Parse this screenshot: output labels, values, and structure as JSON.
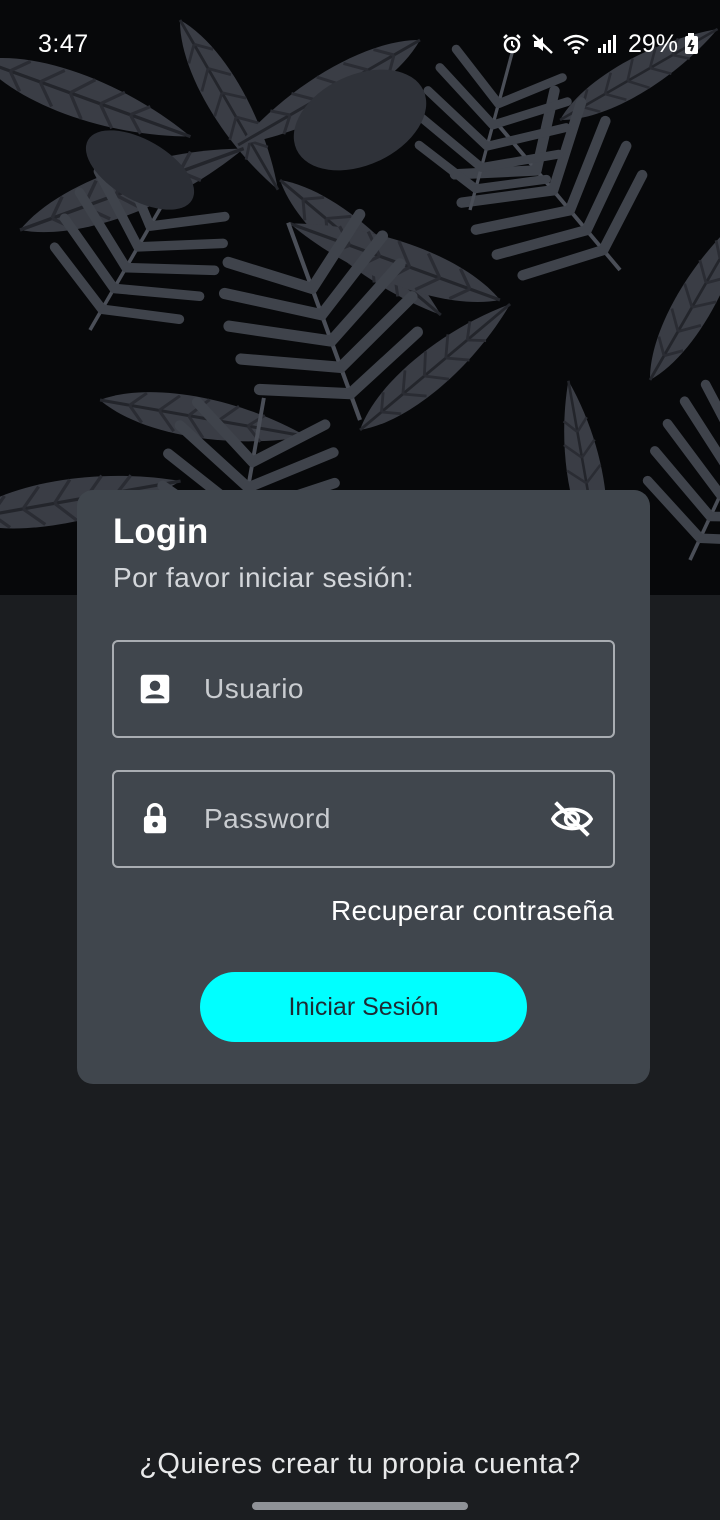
{
  "status_bar": {
    "time": "3:47",
    "battery": "29%",
    "icons": [
      "alarm-icon",
      "mute-icon",
      "wifi-icon",
      "signal-icon",
      "battery-icon"
    ]
  },
  "login_card": {
    "title": "Login",
    "subtitle": "Por favor iniciar sesión:",
    "username_placeholder": "Usuario",
    "password_placeholder": "Password",
    "recover_label": "Recuperar contraseña",
    "submit_label": "Iniciar Sesión"
  },
  "footer": {
    "signup_label": "¿Quieres crear tu propia cuenta?"
  },
  "colors": {
    "accent": "#00ffff",
    "card": "#40464d",
    "background": "#1b1d20"
  }
}
